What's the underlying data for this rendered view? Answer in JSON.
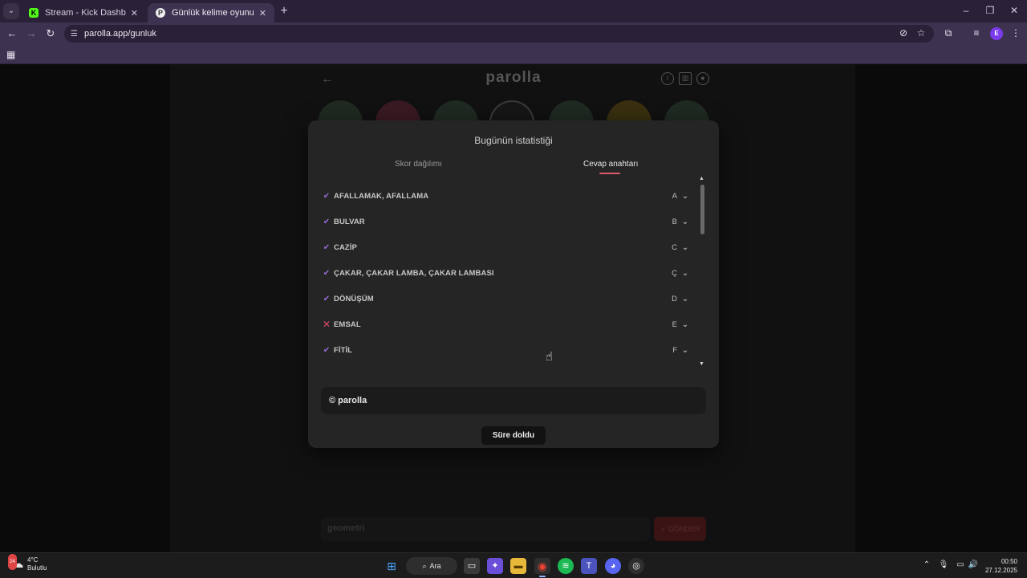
{
  "browser": {
    "tabs": [
      {
        "title": "Stream - Kick Dashboard",
        "favicon": "kick-icon"
      },
      {
        "title": "Günlük kelime oyunu - parolla",
        "favicon": "parolla-icon"
      }
    ],
    "url": "parolla.app/gunluk",
    "profile_initial": "E"
  },
  "game": {
    "logo": "parolla",
    "bubble_colors": [
      "#202a20",
      "#3a1a22",
      "#1f2a22",
      "#161616",
      "#1f2a22",
      "#3a3010",
      "#1f2a22"
    ],
    "bottom_placeholder": "geometri",
    "bottom_button": "✓ GÖNDER"
  },
  "modal": {
    "title": "Bugünün istatistiği",
    "tabs": [
      "Skor dağılımı",
      "Cevap anahtarı"
    ],
    "active_tab": "Cevap anahtarı",
    "answers": [
      {
        "word": "AFALLAMAK, AFALLAMA",
        "letter": "A",
        "correct": true
      },
      {
        "word": "BULVAR",
        "letter": "B",
        "correct": true
      },
      {
        "word": "CAZİP",
        "letter": "C",
        "correct": true
      },
      {
        "word": "ÇAKAR, ÇAKAR LAMBA, ÇAKAR LAMBASI",
        "letter": "Ç",
        "correct": true
      },
      {
        "word": "DÖNÜŞÜM",
        "letter": "D",
        "correct": true
      },
      {
        "word": "EMSAL",
        "letter": "E",
        "correct": false
      },
      {
        "word": "FİTİL",
        "letter": "F",
        "correct": true
      }
    ],
    "footer": "© parolla",
    "timeout_button": "Süre doldu"
  },
  "taskbar": {
    "weather_temp": "4°C",
    "weather_desc": "Bulutlu",
    "weather_badge": "24",
    "search_label": "Ara",
    "time": "00:50",
    "date": "27.12.2025"
  },
  "colors": {
    "correct": "#9a6ad8",
    "wrong": "#e2486a",
    "accent_underline": "#e15a6c"
  }
}
